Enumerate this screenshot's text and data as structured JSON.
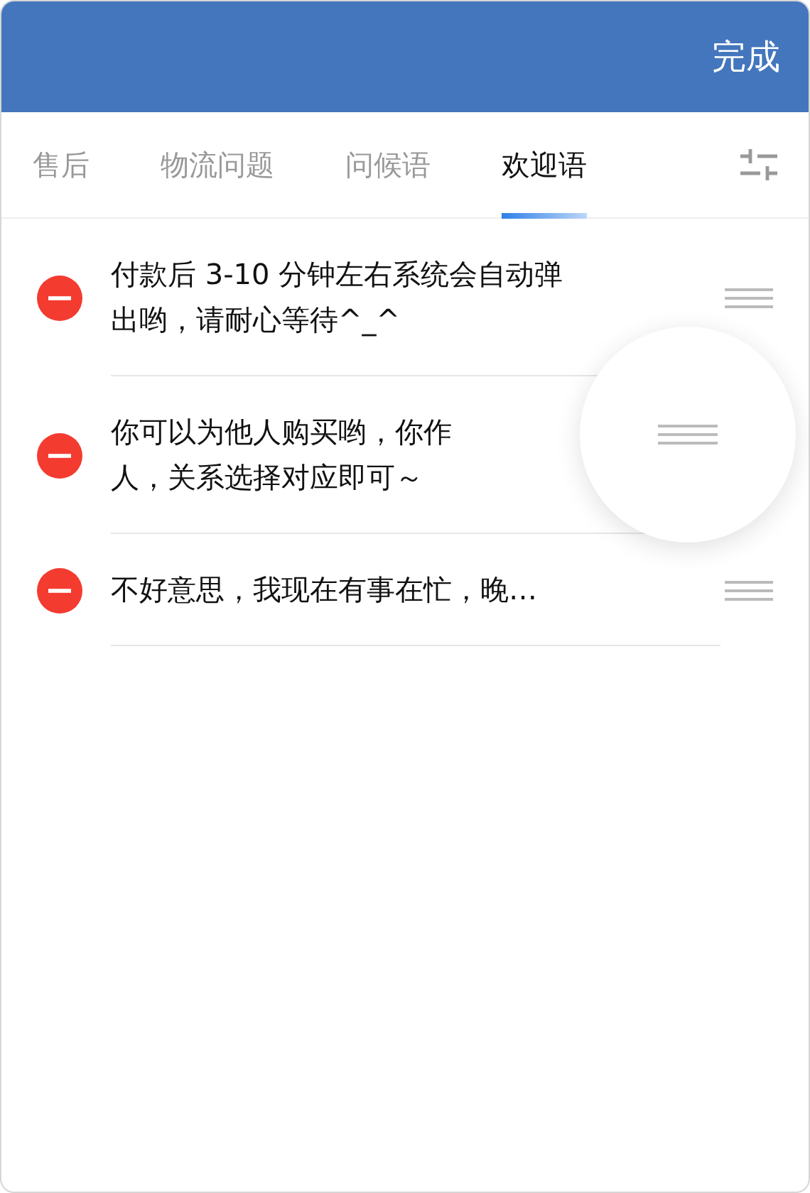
{
  "header": {
    "done_button": "完成"
  },
  "tabs": [
    {
      "label": "售后",
      "selected": false
    },
    {
      "label": "物流问题",
      "selected": false
    },
    {
      "label": "问候语",
      "selected": false
    },
    {
      "label": "欢迎语",
      "selected": true
    }
  ],
  "items": [
    {
      "text": "付款后 3-10 分钟左右系统会自动弹出哟，请耐心等待^_^",
      "dragging": false
    },
    {
      "text": "你可以为他人购买哟，你作人，关系选择对应即可～",
      "dragging": true
    },
    {
      "text": "不好意思，我现在有事在忙，晚…",
      "dragging": false
    }
  ]
}
